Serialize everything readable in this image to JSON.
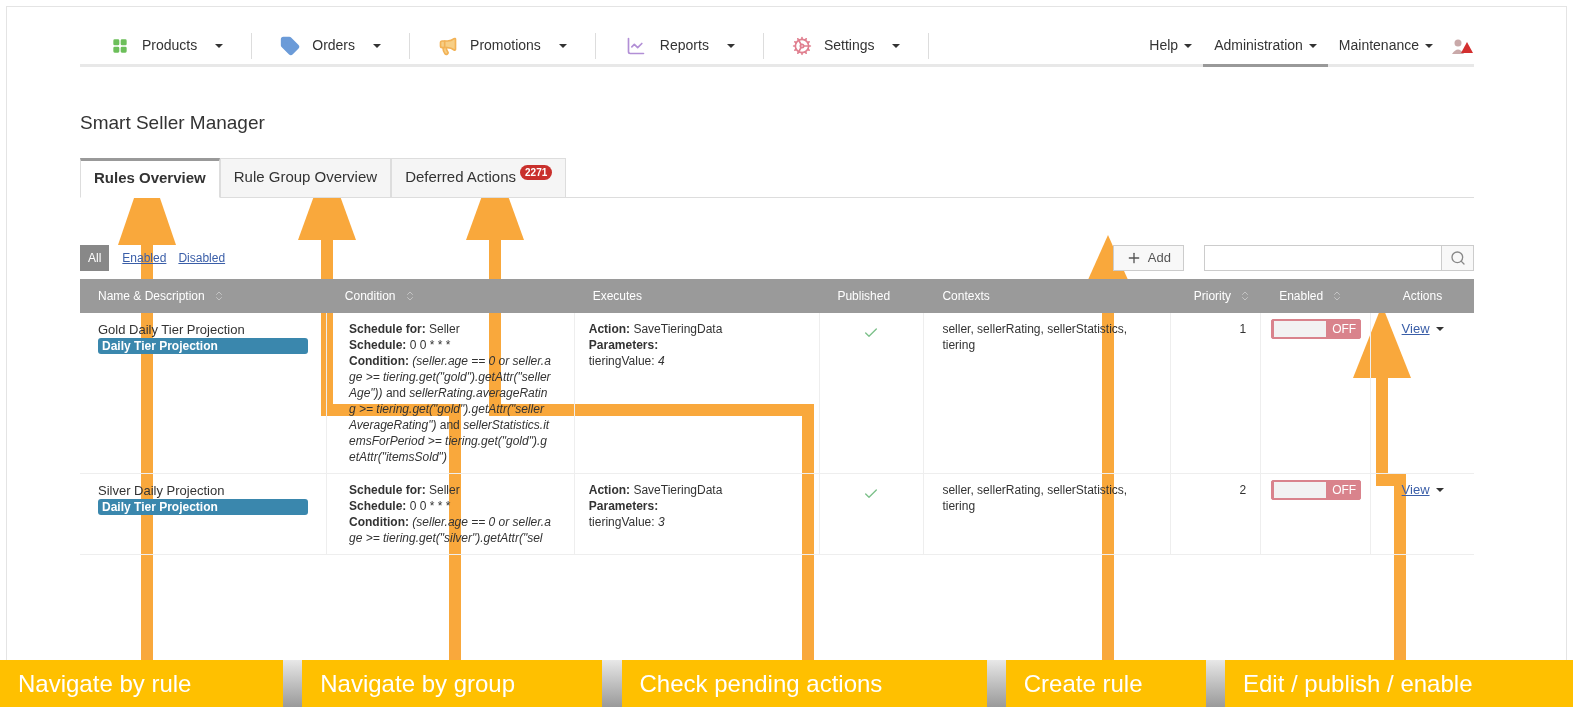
{
  "nav": {
    "left": [
      {
        "label": "Products",
        "kind": "grid",
        "selected": false
      },
      {
        "label": "Orders",
        "kind": "tag",
        "selected": false
      },
      {
        "label": "Promotions",
        "kind": "megaphone",
        "selected": false
      },
      {
        "label": "Reports",
        "kind": "chart",
        "selected": false
      },
      {
        "label": "Settings",
        "kind": "gear",
        "selected": false
      }
    ],
    "right": [
      {
        "label": "Help",
        "selected": false
      },
      {
        "label": "Administration",
        "selected": true
      },
      {
        "label": "Maintenance",
        "selected": false
      }
    ]
  },
  "title": "Smart Seller Manager",
  "tabs": [
    {
      "label": "Rules Overview",
      "selected": true
    },
    {
      "label": "Rule Group Overview",
      "selected": false
    },
    {
      "label": "Deferred Actions",
      "selected": false,
      "badge": "2271"
    }
  ],
  "filters": [
    {
      "label": "All",
      "selected": true
    },
    {
      "label": "Enabled",
      "selected": false
    },
    {
      "label": "Disabled",
      "selected": false
    }
  ],
  "add_button": "Add",
  "table": {
    "columns": [
      {
        "label": "Name & Description",
        "sortable": true
      },
      {
        "label": "Condition",
        "sortable": true
      },
      {
        "label": "Executes",
        "sortable": false
      },
      {
        "label": "Published",
        "sortable": false
      },
      {
        "label": "Contexts",
        "sortable": false
      },
      {
        "label": "Priority",
        "sortable": true
      },
      {
        "label": "Enabled",
        "sortable": true
      },
      {
        "label": "Actions",
        "sortable": false
      }
    ],
    "rows": [
      {
        "name": "Gold Daily Tier Projection",
        "group": "Daily Tier Projection",
        "schedule_for": "**Schedule for:** Seller",
        "schedule": "**Schedule:** 0 0 * * *",
        "condition": "**Condition:** *(seller.age == 0 or seller.age >= tiering.get(\"gold\").getAttr(\"sellerAge\"))* and *sellerRating.averageRating >= tiering.get(\"gold\").getAttr(\"sellerAverageRating\")* and *sellerStatistics.itemsForPeriod >= tiering.get(\"gold\").getAttr(\"itemsSold\")*",
        "action": "**Action:** SaveTieringData",
        "parameters": "Parameters:",
        "param_value": "tieringValue: *4*",
        "published": true,
        "contexts": "seller, sellerRating, sellerStatistics, tiering",
        "priority": "1",
        "enabled": false,
        "toggle_label": "OFF",
        "action_link": "View"
      },
      {
        "name": "Silver Daily Projection",
        "group": "Daily Tier Projection",
        "schedule_for": "**Schedule for:** Seller",
        "schedule": "**Schedule:** 0 0 * * *",
        "condition": "**Condition:** *(seller.age == 0 or seller.age >= tiering.get(\"silver\").getAttr(\"sel*",
        "action": "**Action:** SaveTieringData",
        "parameters": "Parameters:",
        "param_value": "tieringValue: *3*",
        "published": true,
        "contexts": "seller, sellerRating, sellerStatistics, tiering",
        "priority": "2",
        "enabled": false,
        "toggle_label": "OFF",
        "action_link": "View"
      }
    ]
  },
  "callouts": [
    "Navigate by rule",
    "Navigate by group",
    "Check pending actions",
    "Create rule",
    "Edit / publish / enable"
  ]
}
